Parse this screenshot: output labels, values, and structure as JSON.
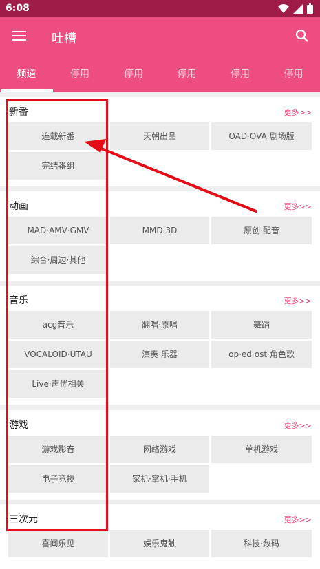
{
  "status": {
    "time": "6:08"
  },
  "appbar": {
    "title": "吐槽"
  },
  "tabs": [
    "频道",
    "停用",
    "停用",
    "停用",
    "停用",
    "停用"
  ],
  "more_label": "更多>>",
  "sections": [
    {
      "title": "新番",
      "items": [
        "连载新番",
        "天朝出品",
        "OAD·OVA·剧场版",
        "完结番组"
      ]
    },
    {
      "title": "动画",
      "items": [
        "MAD·AMV·GMV",
        "MMD·3D",
        "原创·配音",
        "综合·周边·其他"
      ]
    },
    {
      "title": "音乐",
      "items": [
        "acg音乐",
        "翻唱·原唱",
        "舞蹈",
        "VOCALOID·UTAU",
        "演奏·乐器",
        "op·ed·ost·角色歌",
        "Live·声优相关"
      ]
    },
    {
      "title": "游戏",
      "items": [
        "游戏影音",
        "网络游戏",
        "单机游戏",
        "电子竞技",
        "家机·掌机·手机"
      ]
    },
    {
      "title": "三次元",
      "items": [
        "喜闻乐见",
        "娱乐鬼触",
        "科技·数码"
      ]
    }
  ],
  "colors": {
    "primary": "#ee4d7f",
    "status_bar": "#9e1c47",
    "highlight_box": "#e30d18"
  },
  "icons": [
    "menu-icon",
    "search-icon",
    "wifi-icon",
    "signal-icon",
    "battery-icon"
  ]
}
